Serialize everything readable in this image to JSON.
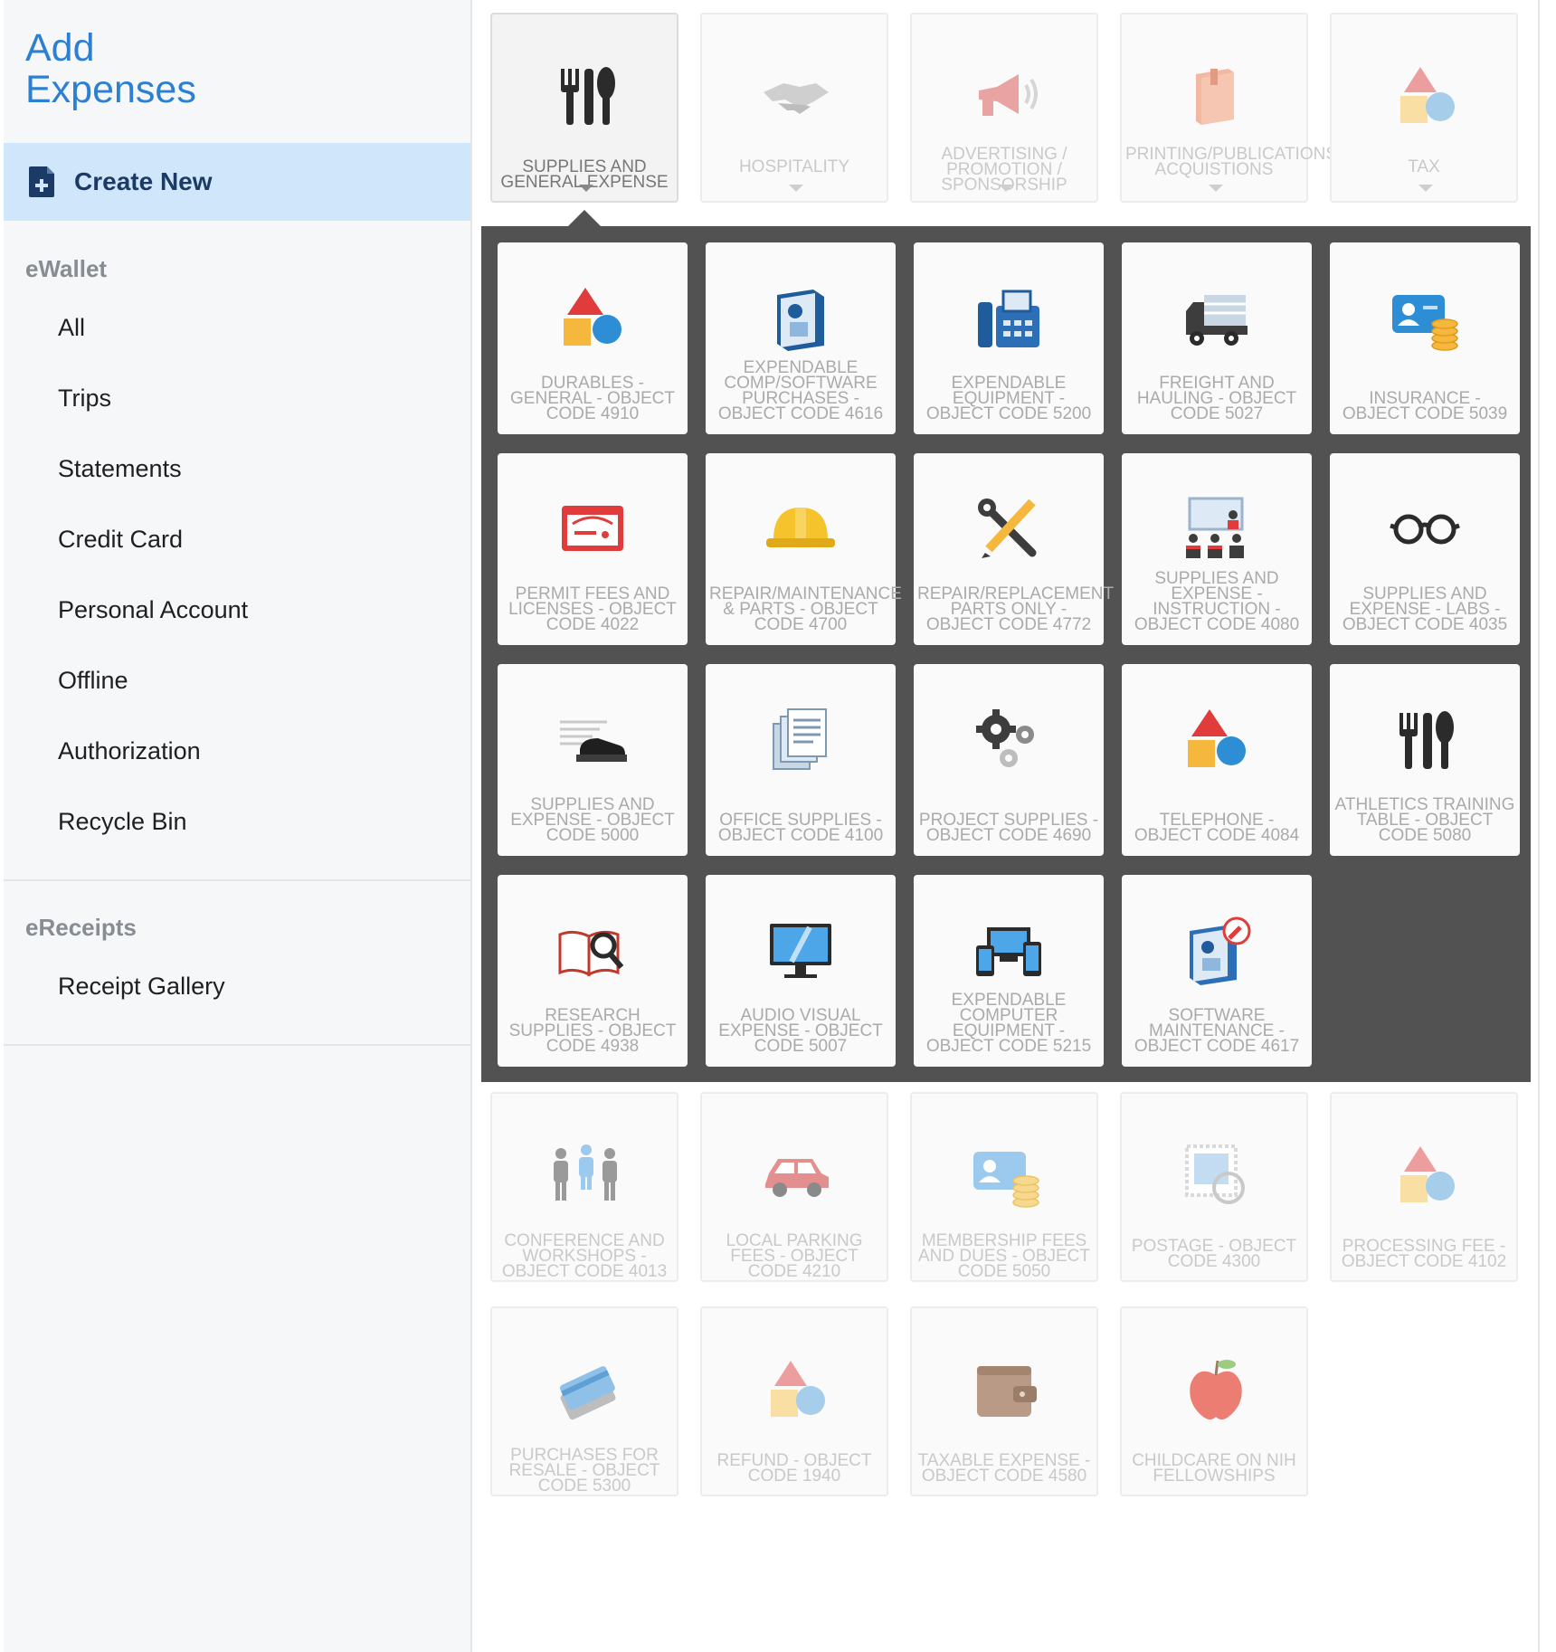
{
  "sidebar": {
    "title": "Add Expenses",
    "create_new": "Create New",
    "ewallet_header": "eWallet",
    "ewallet_items": [
      "All",
      "Trips",
      "Statements",
      "Credit Card",
      "Personal Account",
      "Offline",
      "Authorization",
      "Recycle Bin"
    ],
    "ereceipts_header": "eReceipts",
    "ereceipts_items": [
      "Receipt Gallery"
    ]
  },
  "categories_top": [
    {
      "label": "SUPPLIES AND GENERAL EXPENSE",
      "icon": "utensils-icon",
      "selected": true
    },
    {
      "label": "HOSPITALITY",
      "icon": "handshake-icon"
    },
    {
      "label": "ADVERTISING / PROMOTION / SPONSORSHIP",
      "icon": "megaphone-icon"
    },
    {
      "label": "PRINTING/PUBLICATIONS/LIBRARY ACQUISTIONS",
      "icon": "book-icon"
    },
    {
      "label": "TAX",
      "icon": "shapes-icon"
    }
  ],
  "subcategories": [
    {
      "label": "DURABLES - GENERAL - OBJECT CODE 4910",
      "icon": "shapes-icon"
    },
    {
      "label": "EXPENDABLE COMP/SOFTWARE PURCHASES - OBJECT CODE 4616",
      "icon": "software-box-icon"
    },
    {
      "label": "EXPENDABLE EQUIPMENT - OBJECT CODE 5200",
      "icon": "fax-icon"
    },
    {
      "label": "FREIGHT AND HAULING - OBJECT CODE 5027",
      "icon": "truck-icon"
    },
    {
      "label": "INSURANCE - OBJECT CODE 5039",
      "icon": "id-card-coins-icon"
    },
    {
      "label": "PERMIT FEES AND LICENSES - OBJECT CODE 4022",
      "icon": "permit-icon"
    },
    {
      "label": "REPAIR/MAINTENANCE & PARTS - OBJECT CODE 4700",
      "icon": "hard-hat-icon"
    },
    {
      "label": "REPAIR/REPLACEMENT PARTS ONLY - OBJECT CODE 4772",
      "icon": "tools-icon"
    },
    {
      "label": "SUPPLIES AND EXPENSE - INSTRUCTION - OBJECT CODE 4080",
      "icon": "classroom-icon"
    },
    {
      "label": "SUPPLIES AND EXPENSE - LABS - OBJECT CODE 4035",
      "icon": "glasses-icon"
    },
    {
      "label": "SUPPLIES AND EXPENSE - OBJECT CODE 5000",
      "icon": "stapler-icon"
    },
    {
      "label": "OFFICE SUPPLIES - OBJECT CODE 4100",
      "icon": "documents-icon"
    },
    {
      "label": "PROJECT SUPPLIES - OBJECT CODE 4690",
      "icon": "gears-icon"
    },
    {
      "label": "TELEPHONE - OBJECT CODE 4084",
      "icon": "shapes-icon"
    },
    {
      "label": "ATHLETICS TRAINING TABLE - OBJECT CODE 5080",
      "icon": "utensils-icon"
    },
    {
      "label": "RESEARCH SUPPLIES - OBJECT CODE 4938",
      "icon": "book-magnifier-icon"
    },
    {
      "label": "AUDIO VISUAL EXPENSE - OBJECT CODE 5007",
      "icon": "monitor-icon"
    },
    {
      "label": "EXPENDABLE COMPUTER EQUIPMENT - OBJECT CODE 5215",
      "icon": "devices-icon"
    },
    {
      "label": "SOFTWARE MAINTENANCE - OBJECT CODE 4617",
      "icon": "software-wrench-icon"
    }
  ],
  "categories_bottom": [
    {
      "label": "CONFERENCE AND WORKSHOPS - OBJECT CODE 4013",
      "icon": "people-icon"
    },
    {
      "label": "LOCAL PARKING FEES - OBJECT CODE 4210",
      "icon": "car-icon"
    },
    {
      "label": "MEMBERSHIP FEES AND DUES - OBJECT CODE 5050",
      "icon": "id-card-coins-icon"
    },
    {
      "label": "POSTAGE - OBJECT CODE 4300",
      "icon": "stamp-icon"
    },
    {
      "label": "PROCESSING FEE - OBJECT CODE 4102",
      "icon": "shapes-icon"
    },
    {
      "label": "PURCHASES FOR RESALE - OBJECT CODE 5300",
      "icon": "credit-cards-icon"
    },
    {
      "label": "REFUND - OBJECT CODE 1940",
      "icon": "shapes-icon"
    },
    {
      "label": "TAXABLE EXPENSE - OBJECT CODE 4580",
      "icon": "wallet-icon"
    },
    {
      "label": "CHILDCARE ON NIH FELLOWSHIPS",
      "icon": "apple-icon"
    }
  ]
}
